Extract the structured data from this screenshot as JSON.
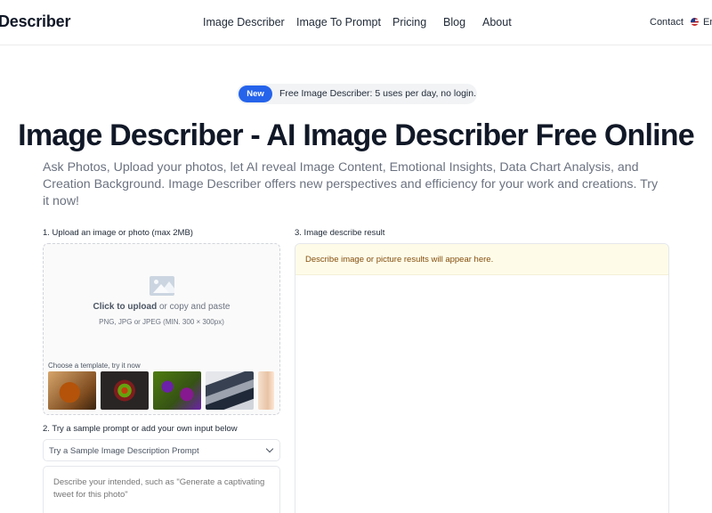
{
  "header": {
    "logo": "Describer",
    "nav": [
      "Image Describer",
      "Image To Prompt",
      "Pricing",
      "Blog",
      "About"
    ],
    "contact": "Contact",
    "language": "En"
  },
  "announcement": {
    "badge": "New",
    "text": "Free Image Describer: 5 uses per day, no login."
  },
  "hero": {
    "title": "Image Describer - AI Image Describer Free Online",
    "subtitle": "Ask Photos, Upload your photos, let AI reveal Image Content, Emotional Insights, Data Chart Analysis, and Creation Background. Image Describer offers new perspectives and efficiency for your work and creations. Try it now!"
  },
  "upload": {
    "section_label": "1. Upload an image or photo (max 2MB)",
    "click_text": "Click to upload",
    "or_text": " or copy and paste",
    "hint": "PNG, JPG or JPEG (MIN. 300 × 300px)",
    "template_label": "Choose a template, try it now",
    "templates": [
      "template-1",
      "template-2",
      "template-3",
      "template-4",
      "template-5"
    ]
  },
  "prompt": {
    "section_label": "2. Try a sample prompt or add your own input below",
    "select_value": "Try a Sample Image Description Prompt",
    "textarea_placeholder": "Describe your intended, such as \"Generate a captivating tweet for this photo\""
  },
  "result": {
    "section_label": "3. Image describe result",
    "placeholder": "Describe image or picture results will appear here."
  },
  "colors": {
    "accent": "#2563eb",
    "result_bg": "#fefce8",
    "result_text": "#854d0e"
  }
}
